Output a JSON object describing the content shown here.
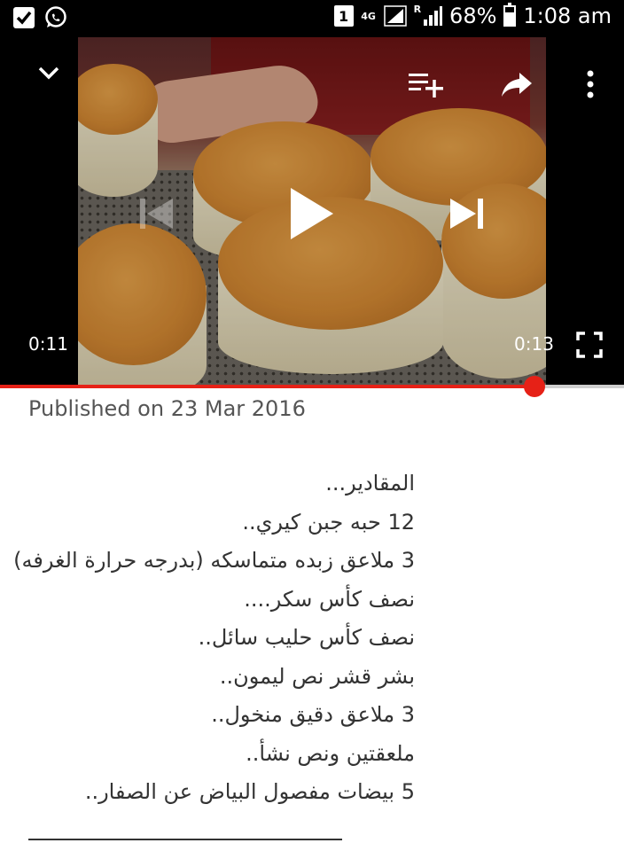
{
  "status_bar": {
    "notifications": [
      "checkbox-icon",
      "whatsapp-icon"
    ],
    "sim_slot": "1",
    "network": "4G",
    "roaming": "R",
    "battery_percent": "68%",
    "battery_level": 0.68,
    "time": "1:08 am"
  },
  "player": {
    "current_time": "0:11",
    "duration": "0:13",
    "progress": 0.857,
    "icons": {
      "minimize": "chevron-down-icon",
      "add_to_queue": "add-to-playlist-icon",
      "share": "share-icon",
      "more": "more-vert-icon",
      "previous": "skip-previous-icon",
      "play": "play-icon",
      "next": "skip-next-icon",
      "fullscreen": "fullscreen-icon"
    },
    "colors": {
      "progress": "#e62117",
      "track": "#cfcfcf"
    }
  },
  "description": {
    "published": "Published on 23 Mar 2016",
    "lines": [
      "المقادير...",
      "12 حبه جبن كيري..",
      "3 ملاعق زبده متماسكه (بدرجه حرارة الغرفه)",
      "نصف كأس سكر....",
      "نصف كأس حليب سائل..",
      "بشر قشر نص ليمون..",
      "3 ملاعق دقيق منخول..",
      "ملعقتين ونص نشأ..",
      "5 بيضات مفصول البياض عن الصفار.."
    ]
  }
}
